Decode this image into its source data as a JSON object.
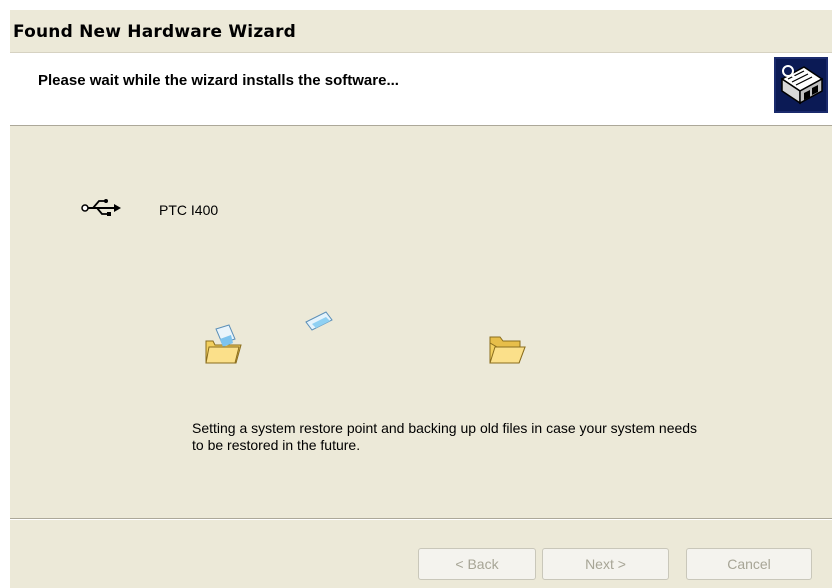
{
  "window": {
    "title": "Found New Hardware Wizard"
  },
  "header": {
    "title": "Please wait while the wizard installs the software...",
    "icon": "hardware-wizard-icon"
  },
  "device": {
    "icon": "usb-icon",
    "name": "PTC I400"
  },
  "animation": {
    "source_icon": "folder-with-document-icon",
    "moving_icon": "flying-document-icon",
    "destination_icon": "open-folder-icon"
  },
  "status": {
    "text": "Setting a system restore point and backing up old files in case your system needs to be restored in the future."
  },
  "buttons": {
    "back_label": "< Back",
    "next_label": "Next >",
    "cancel_label": "Cancel",
    "back_enabled": false,
    "next_enabled": false,
    "cancel_enabled": false
  },
  "colors": {
    "dialog_bg": "#ece9d8",
    "header_bg": "#ffffff",
    "disabled_text": "#a7a596"
  }
}
